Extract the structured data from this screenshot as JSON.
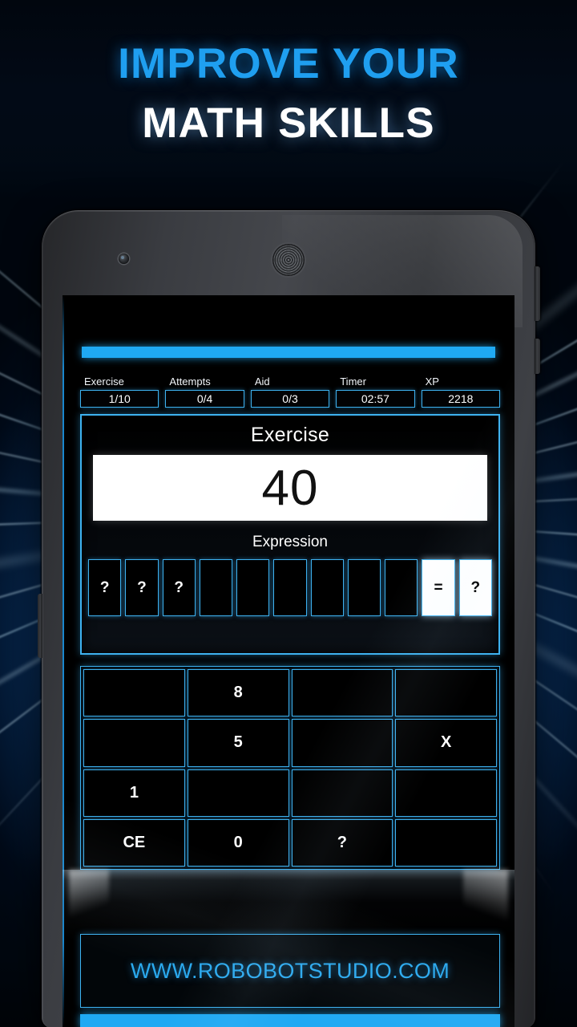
{
  "headline": {
    "line1": "IMPROVE YOUR",
    "line2": "MATH SKILLS"
  },
  "colors": {
    "accent_blue": "#1fa9f3",
    "border_blue": "#3eb2f0",
    "headline_blue": "#1f9ff0",
    "screen_black": "#000000",
    "answer_white": "#ffffff"
  },
  "phone": {
    "camera_icon": "camera-icon",
    "speaker_icon": "speaker-grille-icon"
  },
  "app": {
    "status": [
      {
        "label": "Exercise",
        "value": "1/10"
      },
      {
        "label": "Attempts",
        "value": "0/4"
      },
      {
        "label": "Aid",
        "value": "0/3"
      },
      {
        "label": "Timer",
        "value": "02:57"
      },
      {
        "label": "XP",
        "value": "2218"
      }
    ],
    "exercise": {
      "title": "Exercise",
      "answer": "40",
      "expression_title": "Expression",
      "slots": [
        {
          "text": "?",
          "filled": false
        },
        {
          "text": "?",
          "filled": false
        },
        {
          "text": "?",
          "filled": false
        },
        {
          "text": "",
          "filled": false
        },
        {
          "text": "",
          "filled": false
        },
        {
          "text": "",
          "filled": false
        },
        {
          "text": "",
          "filled": false
        },
        {
          "text": "",
          "filled": false
        },
        {
          "text": "",
          "filled": false
        },
        {
          "text": "=",
          "filled": true
        },
        {
          "text": "?",
          "filled": true
        }
      ]
    },
    "keypad": [
      {
        "text": ""
      },
      {
        "text": "8"
      },
      {
        "text": ""
      },
      {
        "text": ""
      },
      {
        "text": ""
      },
      {
        "text": "5"
      },
      {
        "text": ""
      },
      {
        "text": "X"
      },
      {
        "text": "1"
      },
      {
        "text": ""
      },
      {
        "text": ""
      },
      {
        "text": ""
      },
      {
        "text": "CE"
      },
      {
        "text": "0"
      },
      {
        "text": "?"
      },
      {
        "text": ""
      }
    ],
    "footer": {
      "url": "WWW.ROBOBOTSTUDIO.COM"
    }
  }
}
